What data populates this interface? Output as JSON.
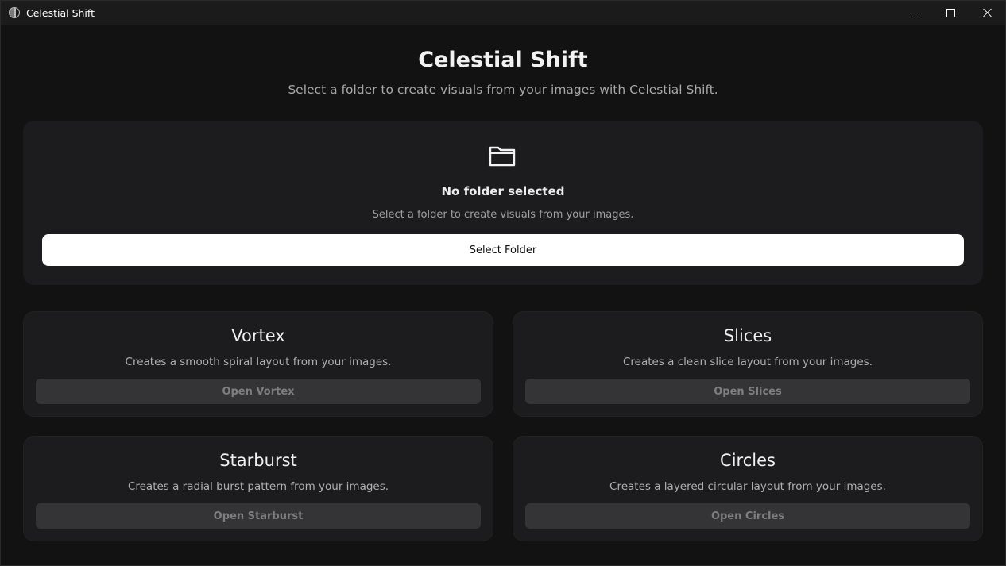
{
  "window": {
    "title": "Celestial Shift"
  },
  "header": {
    "title": "Celestial Shift",
    "subtitle": "Select a folder to create visuals from your images with Celestial Shift."
  },
  "folder_panel": {
    "icon": "folder-icon",
    "heading": "No folder selected",
    "hint": "Select a folder to create visuals from your images.",
    "button_label": "Select Folder"
  },
  "cards": [
    {
      "title": "Vortex",
      "description": "Creates a smooth spiral layout from your images.",
      "button_label": "Open Vortex"
    },
    {
      "title": "Slices",
      "description": "Creates a clean slice layout from your images.",
      "button_label": "Open Slices"
    },
    {
      "title": "Starburst",
      "description": "Creates a radial burst pattern from your images.",
      "button_label": "Open Starburst"
    },
    {
      "title": "Circles",
      "description": "Creates a layered circular layout from your images.",
      "button_label": "Open Circles"
    }
  ],
  "colors": {
    "background": "#121212",
    "panel": "#1c1c1e",
    "primary_button": "#ffffff",
    "disabled_button": "#343436"
  }
}
